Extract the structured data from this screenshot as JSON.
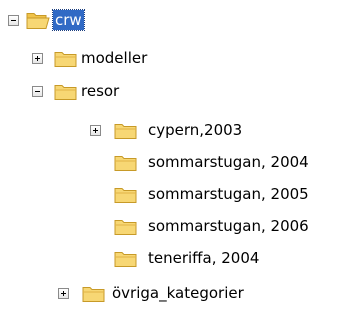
{
  "tree": {
    "root": {
      "label": "crw",
      "expanded": true,
      "selected": true,
      "icon": "folder-open-icon",
      "children": [
        {
          "label": "modeller",
          "expanded": false,
          "has_children": true,
          "icon": "folder-icon"
        },
        {
          "label": "resor",
          "expanded": true,
          "has_children": true,
          "icon": "folder-icon",
          "children": [
            {
              "label": "cypern,2003",
              "expanded": false,
              "has_children": true,
              "icon": "folder-icon"
            },
            {
              "label": "sommarstugan, 2004",
              "has_children": false,
              "icon": "folder-icon"
            },
            {
              "label": "sommarstugan, 2005",
              "has_children": false,
              "icon": "folder-icon"
            },
            {
              "label": "sommarstugan, 2006",
              "has_children": false,
              "icon": "folder-icon"
            },
            {
              "label": "teneriffa, 2004",
              "has_children": false,
              "icon": "folder-icon"
            }
          ]
        },
        {
          "label": "övriga_kategorier",
          "expanded": false,
          "has_children": true,
          "icon": "folder-icon"
        }
      ]
    }
  },
  "colors": {
    "selection_bg": "#316ac5",
    "selection_text": "#ffffff",
    "folder_fill": "#f7d774",
    "folder_stroke": "#c79a28"
  }
}
